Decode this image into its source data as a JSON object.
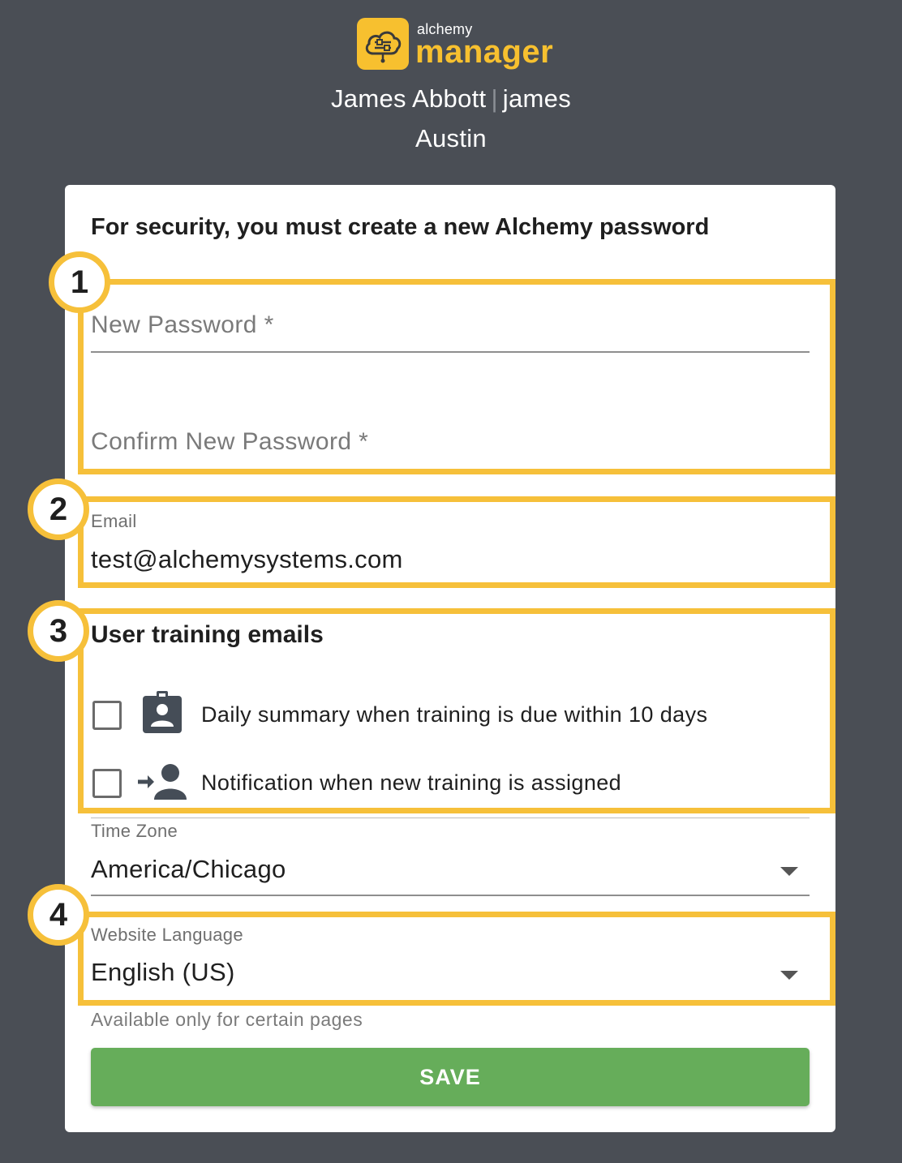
{
  "brand": {
    "small": "alchemy",
    "big": "manager",
    "accent": "#f7c02f"
  },
  "user": {
    "name": "James Abbott",
    "separator": "|",
    "username": "james",
    "location": "Austin"
  },
  "form": {
    "title": "For security, you must create a new Alchemy password",
    "new_password_label": "New Password *",
    "confirm_password_label": "Confirm New Password *",
    "email_label": "Email",
    "email_value": "test@alchemysystems.com",
    "training_section_title": "User training emails",
    "training_options": [
      {
        "label": "Daily summary when training is due within 10 days",
        "icon": "badge-person-icon",
        "checked": false
      },
      {
        "label": "Notification when new training is assigned",
        "icon": "person-add-arrow-icon",
        "checked": false
      }
    ],
    "time_zone_label": "Time Zone",
    "time_zone_value": "America/Chicago",
    "language_label": "Website Language",
    "language_value": "English (US)",
    "language_hint": "Available only for certain pages",
    "save_label": "SAVE",
    "save_color": "#66ad5a"
  },
  "callouts": [
    "1",
    "2",
    "3",
    "4"
  ],
  "callout_color": "#f6c03a"
}
